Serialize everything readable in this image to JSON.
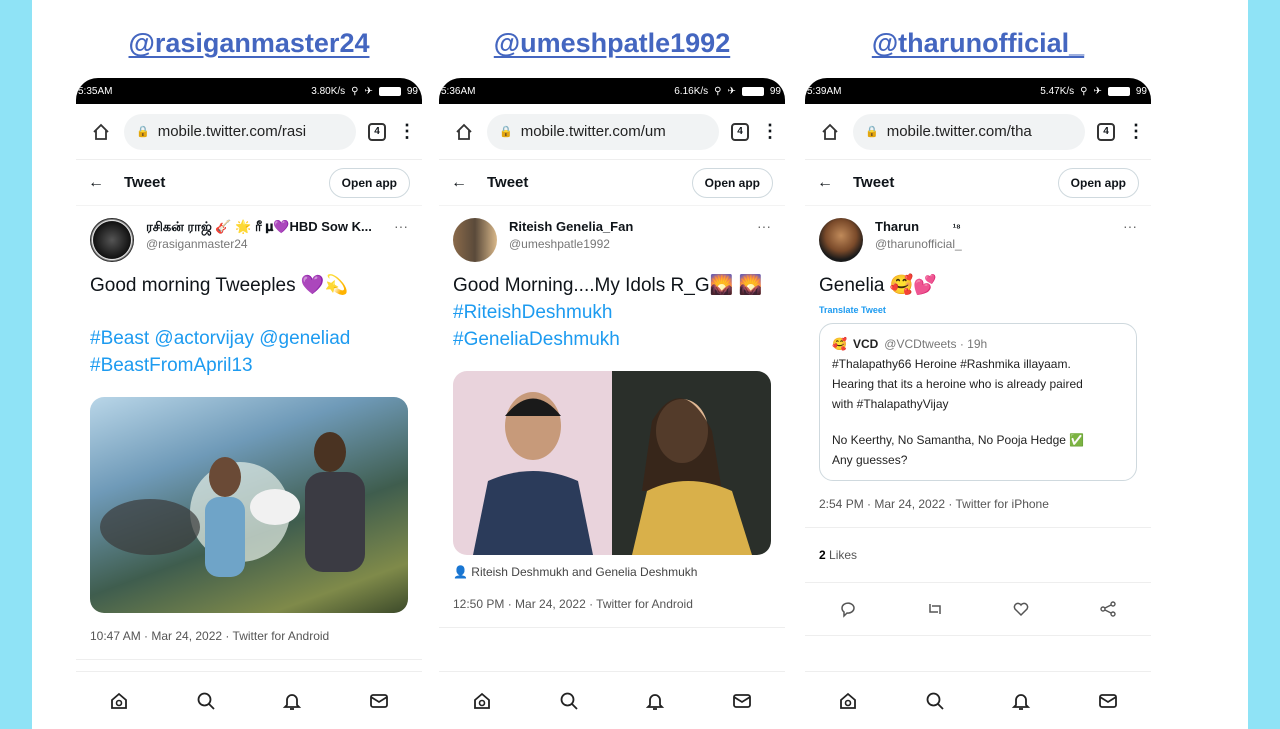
{
  "columns": [
    {
      "handle": "@rasiganmaster24",
      "status_time": "5:35AM",
      "status_net": "3.80K/s",
      "status_battery": "99",
      "url": "mobile.twitter.com/rasi",
      "tab_count": "4",
      "page_title": "Tweet",
      "open_app": "Open app",
      "display_name": "ரசிகன் ராஜ் 🎸 🌟 ரீ 𝛍💜HBD Sow K...",
      "username": "@rasiganmaster24",
      "text_line1": "Good morning Tweeples 💜💫",
      "hashtags": "#Beast @actorvijay @geneliad #BeastFromApril13",
      "meta": "10:47 AM · Mar 24, 2022 · Twitter for Android"
    },
    {
      "handle": "@umeshpatle1992",
      "status_time": "5:36AM",
      "status_net": "6.16K/s",
      "status_battery": "99",
      "url": "mobile.twitter.com/um",
      "tab_count": "4",
      "page_title": "Tweet",
      "open_app": "Open app",
      "display_name": "Riteish Genelia_Fan",
      "username": "@umeshpatle1992",
      "text_line1": "Good Morning....My Idols R_G🌄 🌄",
      "hashtags": "#RiteishDeshmukh #GeneliaDeshmukh",
      "caption": "Riteish Deshmukh and Genelia Deshmukh",
      "meta": "12:50 PM · Mar 24, 2022 · Twitter for Android"
    },
    {
      "handle": "@tharunofficial_",
      "status_time": "5:39AM",
      "status_net": "5.47K/s",
      "status_battery": "99",
      "url": "mobile.twitter.com/tha",
      "tab_count": "4",
      "page_title": "Tweet",
      "open_app": "Open app",
      "display_name": "Tharun",
      "verified": "¹⁸",
      "username": "@tharunofficial_",
      "text_line1": "Genelia 🥰💕",
      "translate": "Translate Tweet",
      "quote": {
        "name": "VCD",
        "handle": "@VCDtweets · 19h",
        "line1": "#Thalapathy66 Heroine #Rashmika illayaam.",
        "line2": "Hearing that its a heroine who is already paired",
        "line3": "with #ThalapathyVijay",
        "line4": "No Keerthy, No Samantha, No Pooja Hedge ✅",
        "line5": "Any guesses?"
      },
      "meta": "2:54 PM · Mar 24, 2022 · Twitter for iPhone",
      "likes_count": "2",
      "likes_label": "Likes"
    }
  ],
  "colors": {
    "background": "#8fe3f6",
    "handle": "#4466c0",
    "link": "#1d9bf0"
  }
}
